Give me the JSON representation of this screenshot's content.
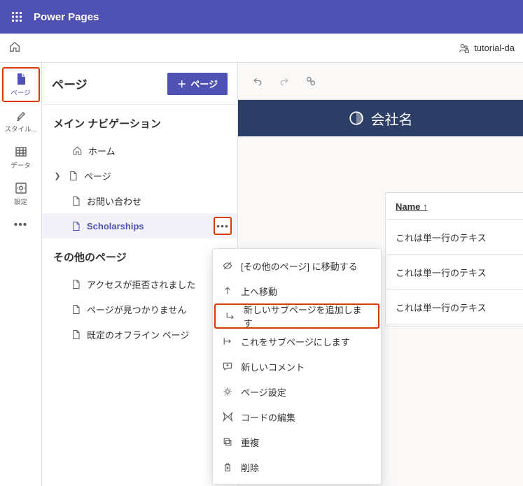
{
  "brand": "Power Pages",
  "environment": "tutorial-da",
  "leftrail": {
    "pages": "ページ",
    "styles": "スタイル...",
    "data": "データ",
    "settings": "設定"
  },
  "panel": {
    "title": "ページ",
    "add_button": "ページ",
    "section_main": "メイン ナビゲーション",
    "section_other": "その他のページ",
    "items": {
      "home": "ホーム",
      "pages": "ページ",
      "contact": "お問い合わせ",
      "scholarships": "Scholarships",
      "access_denied": "アクセスが拒否されました",
      "not_found": "ページが見つかりません",
      "offline": "既定のオフライン ページ"
    }
  },
  "context_menu": {
    "move_other": "[その他のページ] に移動する",
    "move_up": "上へ移動",
    "add_subpage": "新しいサブページを追加します",
    "make_subpage": "これをサブページにします",
    "new_comment": "新しいコメント",
    "page_settings": "ページ設定",
    "edit_code": "コードの編集",
    "duplicate": "重複",
    "delete": "削除"
  },
  "preview": {
    "company": "会社名",
    "column_name": "Name",
    "rows": [
      "これは単一行のテキス",
      "これは単一行のテキス",
      "これは単一行のテキス"
    ]
  }
}
